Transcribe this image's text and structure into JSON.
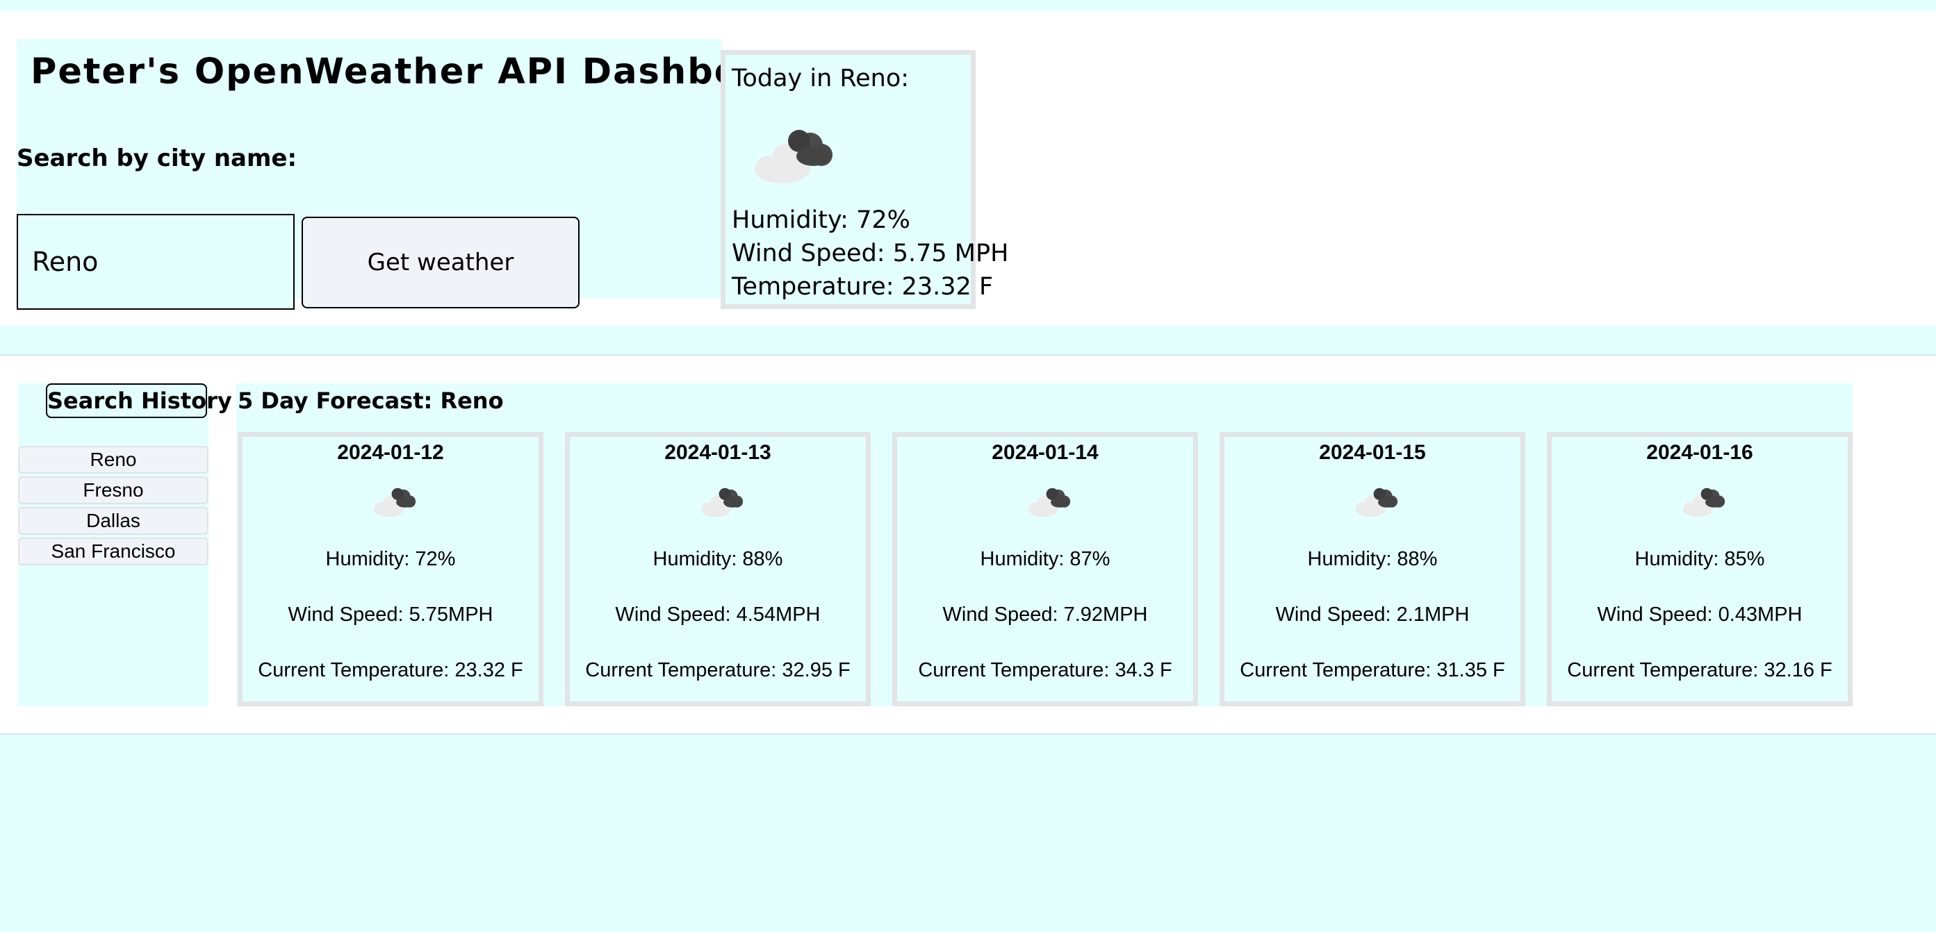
{
  "header": {
    "title": "Peter's OpenWeather API Dashboard",
    "search_label": "Search by city name:",
    "search_value": "Reno",
    "button_label": "Get weather"
  },
  "today": {
    "title": "Today in Reno:",
    "icon": "cloud-icon",
    "humidity": "Humidity: 72%",
    "wind": "Wind Speed: 5.75 MPH",
    "temperature": "Temperature: 23.32 F"
  },
  "history": {
    "title": "Search History",
    "items": [
      "Reno",
      "Fresno",
      "Dallas",
      "San Francisco"
    ]
  },
  "forecast": {
    "title": "5 Day Forecast: Reno",
    "days": [
      {
        "date": "2024-01-12",
        "icon": "cloud-icon",
        "humidity": "Humidity: 72%",
        "wind": "Wind Speed: 5.75MPH",
        "temp": "Current Temperature: 23.32 F"
      },
      {
        "date": "2024-01-13",
        "icon": "cloud-icon",
        "humidity": "Humidity: 88%",
        "wind": "Wind Speed: 4.54MPH",
        "temp": "Current Temperature: 32.95 F"
      },
      {
        "date": "2024-01-14",
        "icon": "cloud-icon",
        "humidity": "Humidity: 87%",
        "wind": "Wind Speed: 7.92MPH",
        "temp": "Current Temperature: 34.3 F"
      },
      {
        "date": "2024-01-15",
        "icon": "cloud-icon",
        "humidity": "Humidity: 88%",
        "wind": "Wind Speed: 2.1MPH",
        "temp": "Current Temperature: 31.35 F"
      },
      {
        "date": "2024-01-16",
        "icon": "cloud-icon",
        "humidity": "Humidity: 85%",
        "wind": "Wind Speed: 0.43MPH",
        "temp": "Current Temperature: 32.16 F"
      }
    ]
  },
  "colors": {
    "background": "#e3fffe",
    "panel": "#ffffff",
    "card_border": "#e2e4e6",
    "button_bg": "#f0f4f8"
  }
}
